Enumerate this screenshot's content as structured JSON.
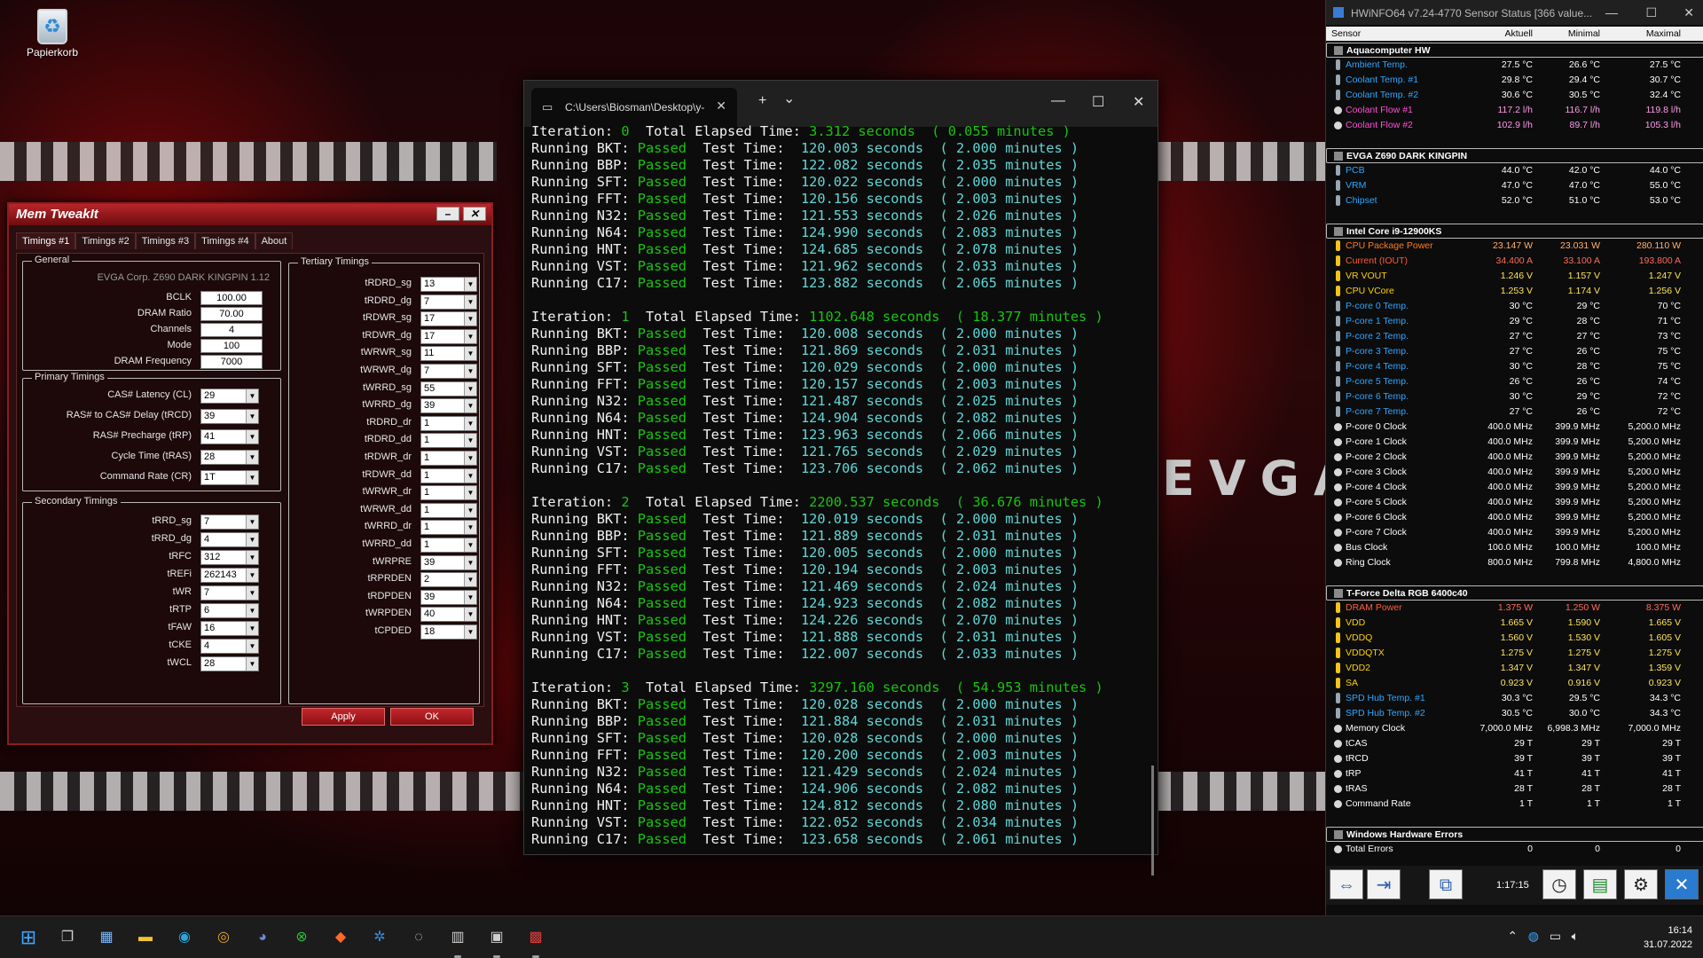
{
  "desktop": {
    "recycle_bin_label": "Papierkorb",
    "wallpaper_logo": "EVGA"
  },
  "memtweak": {
    "title": "Mem TweakIt",
    "minimize_glyph": "–",
    "close_glyph": "✕",
    "tabs": [
      "Timings #1",
      "Timings #2",
      "Timings #3",
      "Timings #4",
      "About"
    ],
    "general": {
      "title": "General",
      "board": "EVGA Corp. Z690 DARK KINGPIN 1.12",
      "rows": [
        {
          "label": "BCLK",
          "value": "100.00"
        },
        {
          "label": "DRAM Ratio",
          "value": "70.00"
        },
        {
          "label": "Channels",
          "value": "4"
        },
        {
          "label": "Mode",
          "value": "100"
        },
        {
          "label": "DRAM Frequency",
          "value": "7000"
        }
      ]
    },
    "primary": {
      "title": "Primary Timings",
      "rows": [
        {
          "label": "CAS# Latency (CL)",
          "value": "29"
        },
        {
          "label": "RAS# to CAS# Delay (tRCD)",
          "value": "39"
        },
        {
          "label": "RAS# Precharge (tRP)",
          "value": "41"
        },
        {
          "label": "Cycle Time (tRAS)",
          "value": "28"
        },
        {
          "label": "Command Rate (CR)",
          "value": "1T"
        }
      ]
    },
    "secondary": {
      "title": "Secondary Timings",
      "rows": [
        {
          "label": "tRRD_sg",
          "value": "7"
        },
        {
          "label": "tRRD_dg",
          "value": "4"
        },
        {
          "label": "tRFC",
          "value": "312"
        },
        {
          "label": "tREFi",
          "value": "262143"
        },
        {
          "label": "tWR",
          "value": "7"
        },
        {
          "label": "tRTP",
          "value": "6"
        },
        {
          "label": "tFAW",
          "value": "16"
        },
        {
          "label": "tCKE",
          "value": "4"
        },
        {
          "label": "tWCL",
          "value": "28"
        }
      ]
    },
    "tertiary": {
      "title": "Tertiary Timings",
      "rows": [
        {
          "label": "tRDRD_sg",
          "value": "13"
        },
        {
          "label": "tRDRD_dg",
          "value": "7"
        },
        {
          "label": "tRDWR_sg",
          "value": "17"
        },
        {
          "label": "tRDWR_dg",
          "value": "17"
        },
        {
          "label": "tWRWR_sg",
          "value": "11"
        },
        {
          "label": "tWRWR_dg",
          "value": "7"
        },
        {
          "label": "tWRRD_sg",
          "value": "55"
        },
        {
          "label": "tWRRD_dg",
          "value": "39"
        },
        {
          "label": "tRDRD_dr",
          "value": "1"
        },
        {
          "label": "tRDRD_dd",
          "value": "1"
        },
        {
          "label": "tRDWR_dr",
          "value": "1"
        },
        {
          "label": "tRDWR_dd",
          "value": "1"
        },
        {
          "label": "tWRWR_dr",
          "value": "1"
        },
        {
          "label": "tWRWR_dd",
          "value": "1"
        },
        {
          "label": "tWRRD_dr",
          "value": "1"
        },
        {
          "label": "tWRRD_dd",
          "value": "1"
        },
        {
          "label": "tWRPRE",
          "value": "39"
        },
        {
          "label": "tRPRDEN",
          "value": "2"
        },
        {
          "label": "tRDPDEN",
          "value": "39"
        },
        {
          "label": "tWRPDEN",
          "value": "40"
        },
        {
          "label": "tCPDED",
          "value": "18"
        }
      ]
    },
    "apply_label": "Apply",
    "ok_label": "OK"
  },
  "terminal": {
    "tab_title": "C:\\Users\\Biosman\\Desktop\\y-",
    "new_tab_glyph": "+",
    "dropdown_glyph": "⌄",
    "minimize_glyph": "—",
    "maximize_glyph": "☐",
    "close_glyph": "✕",
    "iterations": [
      {
        "label": "Iteration: ",
        "num": "0",
        "elapsed_label": "  Total Elapsed Time: ",
        "seconds": "3.312 seconds",
        "minutes": "  ( 0.055 minutes )",
        "tests": [
          {
            "name": "BKT",
            "sec": "120.003",
            "min": "2.000"
          },
          {
            "name": "BBP",
            "sec": "122.082",
            "min": "2.035"
          },
          {
            "name": "SFT",
            "sec": "120.022",
            "min": "2.000"
          },
          {
            "name": "FFT",
            "sec": "120.156",
            "min": "2.003"
          },
          {
            "name": "N32",
            "sec": "121.553",
            "min": "2.026"
          },
          {
            "name": "N64",
            "sec": "124.990",
            "min": "2.083"
          },
          {
            "name": "HNT",
            "sec": "124.685",
            "min": "2.078"
          },
          {
            "name": "VST",
            "sec": "121.962",
            "min": "2.033"
          },
          {
            "name": "C17",
            "sec": "123.882",
            "min": "2.065"
          }
        ]
      },
      {
        "label": "Iteration: ",
        "num": "1",
        "elapsed_label": "  Total Elapsed Time: ",
        "seconds": "1102.648 seconds",
        "minutes": "  ( 18.377 minutes )",
        "tests": [
          {
            "name": "BKT",
            "sec": "120.008",
            "min": "2.000"
          },
          {
            "name": "BBP",
            "sec": "121.869",
            "min": "2.031"
          },
          {
            "name": "SFT",
            "sec": "120.029",
            "min": "2.000"
          },
          {
            "name": "FFT",
            "sec": "120.157",
            "min": "2.003"
          },
          {
            "name": "N32",
            "sec": "121.487",
            "min": "2.025"
          },
          {
            "name": "N64",
            "sec": "124.904",
            "min": "2.082"
          },
          {
            "name": "HNT",
            "sec": "123.963",
            "min": "2.066"
          },
          {
            "name": "VST",
            "sec": "121.765",
            "min": "2.029"
          },
          {
            "name": "C17",
            "sec": "123.706",
            "min": "2.062"
          }
        ]
      },
      {
        "label": "Iteration: ",
        "num": "2",
        "elapsed_label": "  Total Elapsed Time: ",
        "seconds": "2200.537 seconds",
        "minutes": "  ( 36.676 minutes )",
        "tests": [
          {
            "name": "BKT",
            "sec": "120.019",
            "min": "2.000"
          },
          {
            "name": "BBP",
            "sec": "121.889",
            "min": "2.031"
          },
          {
            "name": "SFT",
            "sec": "120.005",
            "min": "2.000"
          },
          {
            "name": "FFT",
            "sec": "120.194",
            "min": "2.003"
          },
          {
            "name": "N32",
            "sec": "121.469",
            "min": "2.024"
          },
          {
            "name": "N64",
            "sec": "124.923",
            "min": "2.082"
          },
          {
            "name": "HNT",
            "sec": "124.226",
            "min": "2.070"
          },
          {
            "name": "VST",
            "sec": "121.888",
            "min": "2.031"
          },
          {
            "name": "C17",
            "sec": "122.007",
            "min": "2.033"
          }
        ]
      },
      {
        "label": "Iteration: ",
        "num": "3",
        "elapsed_label": "  Total Elapsed Time: ",
        "seconds": "3297.160 seconds",
        "minutes": "  ( 54.953 minutes )",
        "tests": [
          {
            "name": "BKT",
            "sec": "120.028",
            "min": "2.000"
          },
          {
            "name": "BBP",
            "sec": "121.884",
            "min": "2.031"
          },
          {
            "name": "SFT",
            "sec": "120.028",
            "min": "2.000"
          },
          {
            "name": "FFT",
            "sec": "120.200",
            "min": "2.003"
          },
          {
            "name": "N32",
            "sec": "121.429",
            "min": "2.024"
          },
          {
            "name": "N64",
            "sec": "124.906",
            "min": "2.082"
          },
          {
            "name": "HNT",
            "sec": "124.812",
            "min": "2.080"
          },
          {
            "name": "VST",
            "sec": "122.052",
            "min": "2.034"
          },
          {
            "name": "C17",
            "sec": "123.658",
            "min": "2.061"
          }
        ]
      }
    ],
    "run_prefix": "Running ",
    "passed": "Passed",
    "test_time_label": "Test Time:",
    "seconds_word": "seconds",
    "minutes_word": "minutes"
  },
  "hwinfo": {
    "title": "HWiNFO64 v7.24-4770 Sensor Status [366 value...",
    "minimize_glyph": "—",
    "maximize_glyph": "☐",
    "close_glyph": "✕",
    "columns": [
      "Sensor",
      "Aktuell",
      "Minimal",
      "Maximal"
    ],
    "groups": [
      {
        "name": "Aquacomputer HW",
        "rows": [
          {
            "name": "Ambient Temp.",
            "cur": "27.5 °C",
            "min": "26.6 °C",
            "max": "27.5 °C",
            "kind": "temp",
            "color": "blue"
          },
          {
            "name": "Coolant Temp. #1",
            "cur": "29.8 °C",
            "min": "29.4 °C",
            "max": "30.7 °C",
            "kind": "temp",
            "color": "blue"
          },
          {
            "name": "Coolant Temp. #2",
            "cur": "30.6 °C",
            "min": "30.5 °C",
            "max": "32.4 °C",
            "kind": "temp",
            "color": "blue"
          },
          {
            "name": "Coolant Flow #1",
            "cur": "117.2 l/h",
            "min": "116.7 l/h",
            "max": "119.8 l/h",
            "kind": "fan",
            "color": "pink"
          },
          {
            "name": "Coolant Flow #2",
            "cur": "102.9 l/h",
            "min": "89.7 l/h",
            "max": "105.3 l/h",
            "kind": "fan",
            "color": "pink"
          }
        ]
      },
      {
        "name": "EVGA Z690 DARK KINGPIN",
        "rows": [
          {
            "name": "PCB",
            "cur": "44.0 °C",
            "min": "42.0 °C",
            "max": "44.0 °C",
            "kind": "temp",
            "color": "blue"
          },
          {
            "name": "VRM",
            "cur": "47.0 °C",
            "min": "47.0 °C",
            "max": "55.0 °C",
            "kind": "temp",
            "color": "blue"
          },
          {
            "name": "Chipset",
            "cur": "52.0 °C",
            "min": "51.0 °C",
            "max": "53.0 °C",
            "kind": "temp",
            "color": "blue"
          }
        ]
      },
      {
        "name": "Intel Core i9-12900KS",
        "rows": [
          {
            "name": "CPU Package Power",
            "cur": "23.147 W",
            "min": "23.031 W",
            "max": "280.110 W",
            "kind": "power",
            "color": "orange"
          },
          {
            "name": "Current (IOUT)",
            "cur": "34.400 A",
            "min": "33.100 A",
            "max": "193.800 A",
            "kind": "power",
            "color": "red"
          },
          {
            "name": "VR VOUT",
            "cur": "1.246 V",
            "min": "1.157 V",
            "max": "1.247 V",
            "kind": "power",
            "color": "yellow"
          },
          {
            "name": "CPU VCore",
            "cur": "1.253 V",
            "min": "1.174 V",
            "max": "1.256 V",
            "kind": "power",
            "color": "yellow"
          },
          {
            "name": "P-core 0 Temp.",
            "cur": "30 °C",
            "min": "29 °C",
            "max": "70 °C",
            "kind": "temp",
            "color": "blue"
          },
          {
            "name": "P-core 1 Temp.",
            "cur": "29 °C",
            "min": "28 °C",
            "max": "71 °C",
            "kind": "temp",
            "color": "blue"
          },
          {
            "name": "P-core 2 Temp.",
            "cur": "27 °C",
            "min": "27 °C",
            "max": "73 °C",
            "kind": "temp",
            "color": "blue"
          },
          {
            "name": "P-core 3 Temp.",
            "cur": "27 °C",
            "min": "26 °C",
            "max": "75 °C",
            "kind": "temp",
            "color": "blue"
          },
          {
            "name": "P-core 4 Temp.",
            "cur": "30 °C",
            "min": "28 °C",
            "max": "75 °C",
            "kind": "temp",
            "color": "blue"
          },
          {
            "name": "P-core 5 Temp.",
            "cur": "26 °C",
            "min": "26 °C",
            "max": "74 °C",
            "kind": "temp",
            "color": "blue"
          },
          {
            "name": "P-core 6 Temp.",
            "cur": "30 °C",
            "min": "29 °C",
            "max": "72 °C",
            "kind": "temp",
            "color": "blue"
          },
          {
            "name": "P-core 7 Temp.",
            "cur": "27 °C",
            "min": "26 °C",
            "max": "72 °C",
            "kind": "temp",
            "color": "blue"
          },
          {
            "name": "P-core 0 Clock",
            "cur": "400.0 MHz",
            "min": "399.9 MHz",
            "max": "5,200.0 MHz",
            "kind": "clock",
            "color": "white"
          },
          {
            "name": "P-core 1 Clock",
            "cur": "400.0 MHz",
            "min": "399.9 MHz",
            "max": "5,200.0 MHz",
            "kind": "clock",
            "color": "white"
          },
          {
            "name": "P-core 2 Clock",
            "cur": "400.0 MHz",
            "min": "399.9 MHz",
            "max": "5,200.0 MHz",
            "kind": "clock",
            "color": "white"
          },
          {
            "name": "P-core 3 Clock",
            "cur": "400.0 MHz",
            "min": "399.9 MHz",
            "max": "5,200.0 MHz",
            "kind": "clock",
            "color": "white"
          },
          {
            "name": "P-core 4 Clock",
            "cur": "400.0 MHz",
            "min": "399.9 MHz",
            "max": "5,200.0 MHz",
            "kind": "clock",
            "color": "white"
          },
          {
            "name": "P-core 5 Clock",
            "cur": "400.0 MHz",
            "min": "399.9 MHz",
            "max": "5,200.0 MHz",
            "kind": "clock",
            "color": "white"
          },
          {
            "name": "P-core 6 Clock",
            "cur": "400.0 MHz",
            "min": "399.9 MHz",
            "max": "5,200.0 MHz",
            "kind": "clock",
            "color": "white"
          },
          {
            "name": "P-core 7 Clock",
            "cur": "400.0 MHz",
            "min": "399.9 MHz",
            "max": "5,200.0 MHz",
            "kind": "clock",
            "color": "white"
          },
          {
            "name": "Bus Clock",
            "cur": "100.0 MHz",
            "min": "100.0 MHz",
            "max": "100.0 MHz",
            "kind": "clock",
            "color": "white"
          },
          {
            "name": "Ring Clock",
            "cur": "800.0 MHz",
            "min": "799.8 MHz",
            "max": "4,800.0 MHz",
            "kind": "clock",
            "color": "white"
          }
        ]
      },
      {
        "name": "T-Force Delta RGB 6400c40",
        "rows": [
          {
            "name": "DRAM Power",
            "cur": "1.375 W",
            "min": "1.250 W",
            "max": "8.375 W",
            "kind": "power",
            "color": "red"
          },
          {
            "name": "VDD",
            "cur": "1.665 V",
            "min": "1.590 V",
            "max": "1.665 V",
            "kind": "power",
            "color": "yellow"
          },
          {
            "name": "VDDQ",
            "cur": "1.560 V",
            "min": "1.530 V",
            "max": "1.605 V",
            "kind": "power",
            "color": "yellow"
          },
          {
            "name": "VDDQTX",
            "cur": "1.275 V",
            "min": "1.275 V",
            "max": "1.275 V",
            "kind": "power",
            "color": "yellow"
          },
          {
            "name": "VDD2",
            "cur": "1.347 V",
            "min": "1.347 V",
            "max": "1.359 V",
            "kind": "power",
            "color": "yellow"
          },
          {
            "name": "SA",
            "cur": "0.923 V",
            "min": "0.916 V",
            "max": "0.923 V",
            "kind": "power",
            "color": "yellow"
          },
          {
            "name": "SPD Hub Temp. #1",
            "cur": "30.3 °C",
            "min": "29.5 °C",
            "max": "34.3 °C",
            "kind": "temp",
            "color": "blue"
          },
          {
            "name": "SPD Hub Temp. #2",
            "cur": "30.5 °C",
            "min": "30.0 °C",
            "max": "34.3 °C",
            "kind": "temp",
            "color": "blue"
          },
          {
            "name": "Memory Clock",
            "cur": "7,000.0 MHz",
            "min": "6,998.3 MHz",
            "max": "7,000.0 MHz",
            "kind": "clock",
            "color": "white"
          },
          {
            "name": "tCAS",
            "cur": "29 T",
            "min": "29 T",
            "max": "29 T",
            "kind": "clock",
            "color": "white"
          },
          {
            "name": "tRCD",
            "cur": "39 T",
            "min": "39 T",
            "max": "39 T",
            "kind": "clock",
            "color": "white"
          },
          {
            "name": "tRP",
            "cur": "41 T",
            "min": "41 T",
            "max": "41 T",
            "kind": "clock",
            "color": "white"
          },
          {
            "name": "tRAS",
            "cur": "28 T",
            "min": "28 T",
            "max": "28 T",
            "kind": "clock",
            "color": "white"
          },
          {
            "name": "Command Rate",
            "cur": "1 T",
            "min": "1 T",
            "max": "1 T",
            "kind": "clock",
            "color": "white"
          }
        ]
      },
      {
        "name": "Windows Hardware Errors",
        "rows": [
          {
            "name": "Total Errors",
            "cur": "0",
            "min": "0",
            "max": "0",
            "kind": "clock",
            "color": "white"
          }
        ]
      }
    ],
    "timer": "1:17:15"
  },
  "taskbar": {
    "clock_time": "16:14",
    "clock_date": "31.07.2022"
  }
}
